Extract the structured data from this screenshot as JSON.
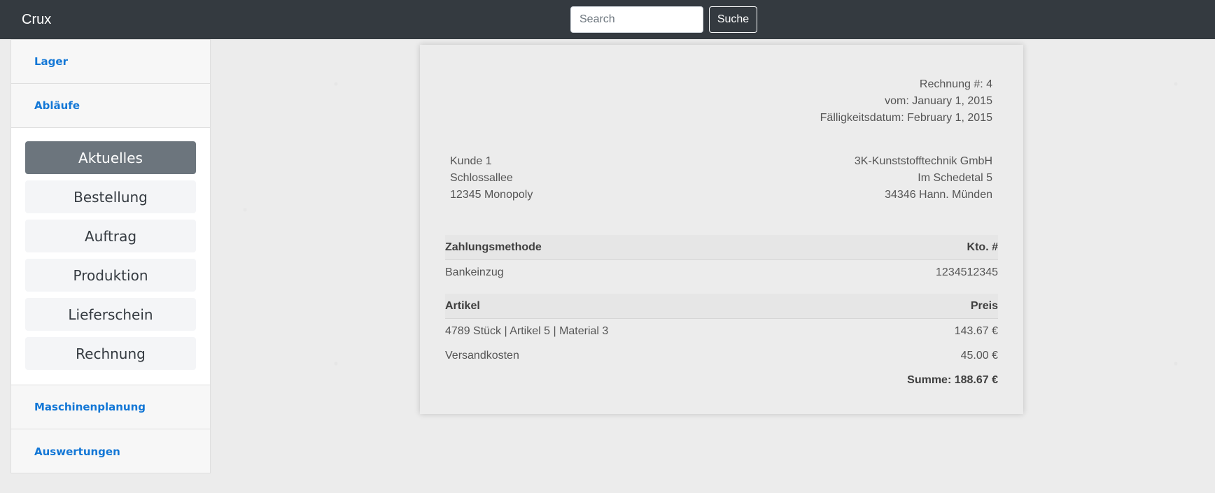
{
  "navbar": {
    "brand": "Crux",
    "search_placeholder": "Search",
    "search_button": "Suche"
  },
  "sidebar": {
    "sections_top": [
      "Lager",
      "Abläufe"
    ],
    "submenu": [
      {
        "label": "Aktuelles",
        "active": true
      },
      {
        "label": "Bestellung",
        "active": false
      },
      {
        "label": "Auftrag",
        "active": false
      },
      {
        "label": "Produktion",
        "active": false
      },
      {
        "label": "Lieferschein",
        "active": false
      },
      {
        "label": "Rechnung",
        "active": false
      }
    ],
    "sections_bottom": [
      "Maschinenplanung",
      "Auswertungen"
    ]
  },
  "invoice": {
    "number": "Rechnung #: 4",
    "date": "vom: January 1, 2015",
    "due": "Fälligkeitsdatum: February 1, 2015",
    "customer": [
      "Kunde 1",
      "Schlossallee",
      "12345 Monopoly"
    ],
    "company": [
      "3K-Kunststofftechnik GmbH",
      "Im Schedetal 5",
      "34346 Hann. Münden"
    ],
    "payment": {
      "header_left": "Zahlungsmethode",
      "header_right": "Kto. #",
      "method": "Bankeinzug",
      "account": "1234512345"
    },
    "items": {
      "header_left": "Artikel",
      "header_right": "Preis",
      "rows": [
        {
          "name": "4789 Stück | Artikel 5 | Material 3",
          "price": "143.67 €"
        },
        {
          "name": "Versandkosten",
          "price": "45.00 €"
        }
      ],
      "total": "Summe: 188.67 €"
    }
  },
  "colors": {
    "navbar": "#343a40",
    "link": "#1377d6",
    "active_item": "#6c757d"
  }
}
